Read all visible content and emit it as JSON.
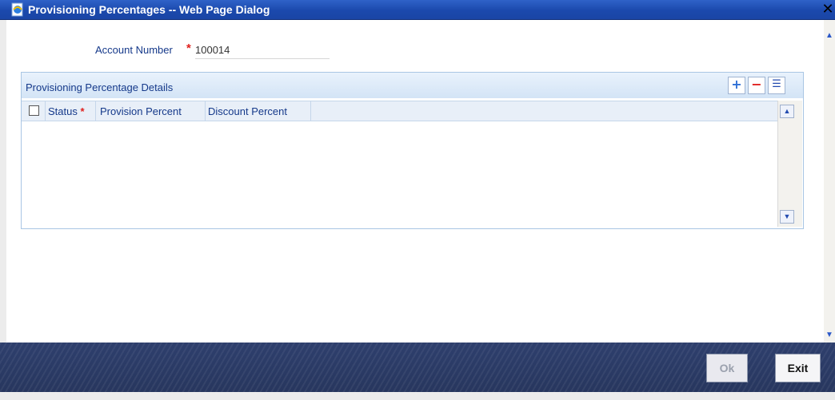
{
  "window": {
    "title": "Provisioning Percentages -- Web Page Dialog",
    "close_glyph": "✕",
    "icon": "ie-page-icon"
  },
  "form": {
    "account_number_label": "Account Number",
    "required_mark": "*",
    "account_number_value": "100014"
  },
  "grid": {
    "title": "Provisioning Percentage Details",
    "tools": {
      "add": "+",
      "remove": "−",
      "list": "☰"
    },
    "columns": [
      {
        "label": "Status",
        "required": "*"
      },
      {
        "label": "Provision Percent"
      },
      {
        "label": "Discount Percent"
      }
    ],
    "rows": []
  },
  "footer": {
    "ok_label": "Ok",
    "exit_label": "Exit"
  },
  "colors": {
    "titlebar": "#1b49ad",
    "label_text": "#15398a",
    "required": "#e0201d",
    "footer": "#2e3f6d"
  }
}
